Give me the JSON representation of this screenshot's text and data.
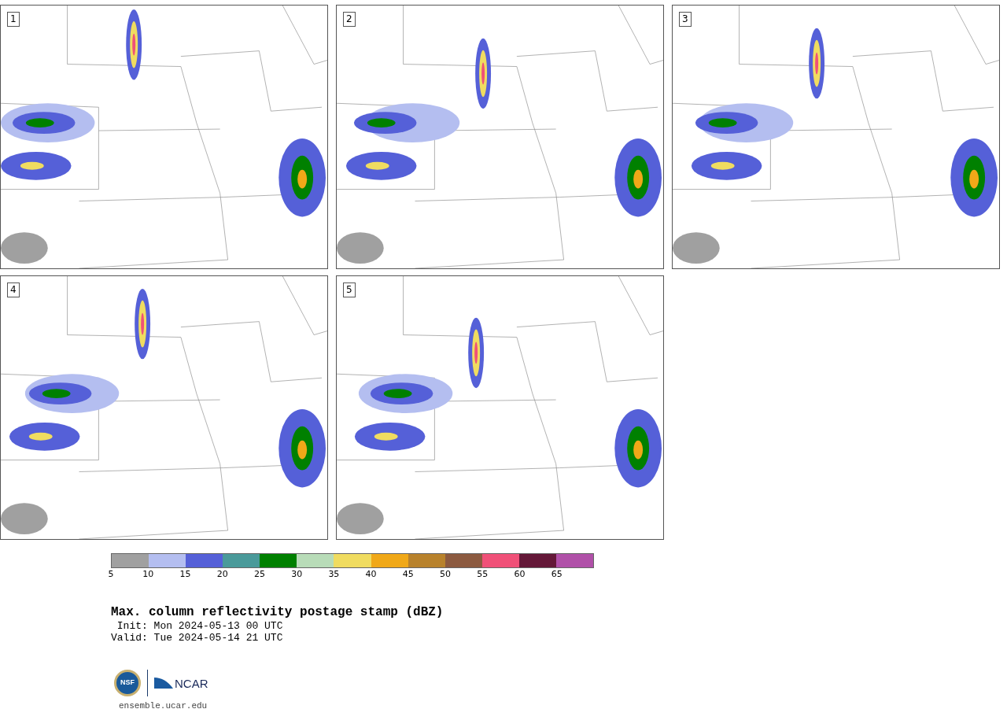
{
  "panels": [
    {
      "number": "1"
    },
    {
      "number": "2"
    },
    {
      "number": "3"
    },
    {
      "number": "4"
    },
    {
      "number": "5"
    }
  ],
  "colorbar": {
    "bins": [
      {
        "color": "#a0a0a0",
        "label": "5"
      },
      {
        "color": "#b4bef0",
        "label": "10"
      },
      {
        "color": "#5560d8",
        "label": "15"
      },
      {
        "color": "#4a9a9a",
        "label": "20"
      },
      {
        "color": "#008000",
        "label": "25"
      },
      {
        "color": "#b8dcb8",
        "label": "30"
      },
      {
        "color": "#f0dc60",
        "label": "35"
      },
      {
        "color": "#f0a818",
        "label": "40"
      },
      {
        "color": "#b8822c",
        "label": "45"
      },
      {
        "color": "#8c5a40",
        "label": "50"
      },
      {
        "color": "#f05078",
        "label": "55"
      },
      {
        "color": "#641838",
        "label": "60"
      },
      {
        "color": "#b050a8",
        "label": "65"
      }
    ]
  },
  "title": "Max. column reflectivity postage stamp (dBZ)",
  "init": " Init: Mon 2024-05-13 00 UTC",
  "valid": "Valid: Tue 2024-05-14 21 UTC",
  "logos": {
    "nsf": "NSF",
    "ncar": "NCAR"
  },
  "url": "ensemble.ucar.edu"
}
